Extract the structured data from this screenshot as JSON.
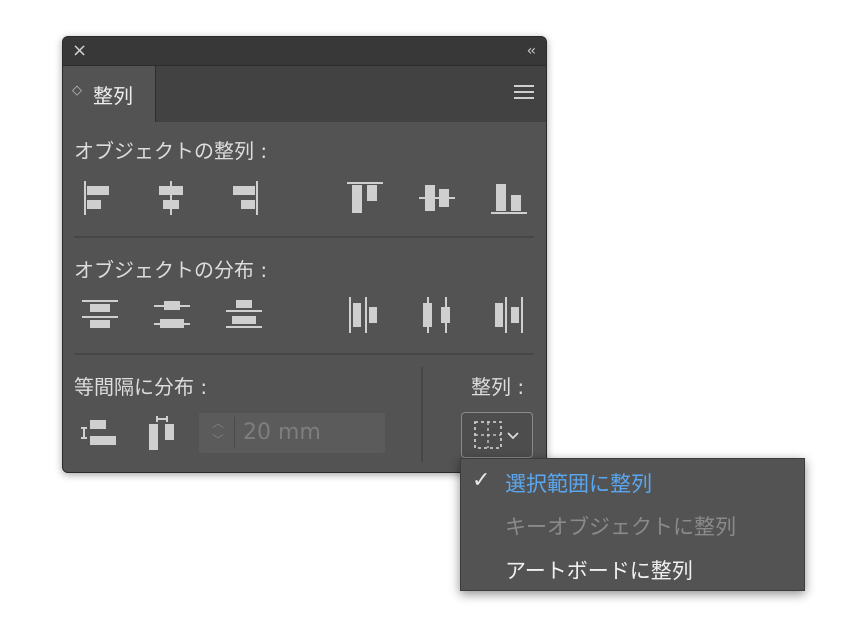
{
  "window": {
    "close_icon": "×",
    "collapse_icon": "‹‹"
  },
  "tab": {
    "label": "整列",
    "arrows_icon": "◇"
  },
  "sections": {
    "align_objects": "オブジェクトの整列 :",
    "distribute_objects": "オブジェクトの分布 :",
    "distribute_spacing": "等間隔に分布 :",
    "align_to": "整列 :"
  },
  "spacing": {
    "value": "20 mm"
  },
  "dropdown": {
    "items": [
      {
        "label": "選択範囲に整列",
        "selected": true,
        "enabled": true
      },
      {
        "label": "キーオブジェクトに整列",
        "selected": false,
        "enabled": false
      },
      {
        "label": "アートボードに整列",
        "selected": false,
        "enabled": true
      }
    ],
    "check_icon": "✓"
  },
  "colors": {
    "panel_bg": "#535353",
    "selected_text": "#5aa7f0",
    "disabled_text": "#8a8a8a"
  }
}
